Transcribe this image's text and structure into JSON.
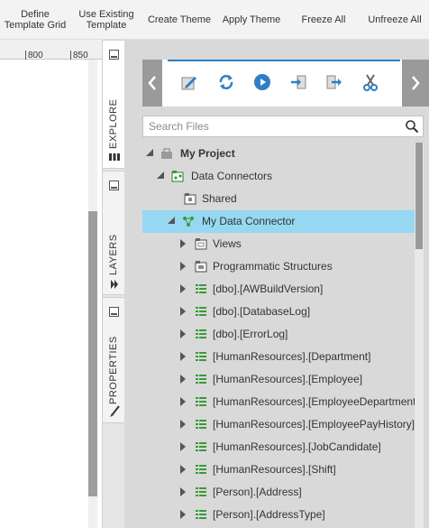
{
  "toolbar": {
    "items": [
      {
        "label": "Define\nTemplate Grid"
      },
      {
        "label": "Use Existing\nTemplate"
      },
      {
        "label": "Create Theme"
      },
      {
        "label": "Apply Theme"
      },
      {
        "label": "Freeze All"
      },
      {
        "label": "Unfreeze All"
      }
    ]
  },
  "ruler": {
    "labels": [
      "800",
      "850"
    ]
  },
  "side_tabs": [
    {
      "label": "EXPLORE",
      "icon": "database-icon",
      "active": true
    },
    {
      "label": "LAYERS",
      "icon": "layers-icon",
      "active": false
    },
    {
      "label": "PROPERTIES",
      "icon": "brush-icon",
      "active": false
    }
  ],
  "ribbon": {
    "tools": [
      "edit-icon",
      "refresh-icon",
      "play-icon",
      "import-icon",
      "export-icon",
      "cut-icon"
    ]
  },
  "search": {
    "placeholder": "Search Files",
    "value": ""
  },
  "tree": [
    {
      "label": "My Project",
      "level": 0,
      "caret": "open",
      "icon": "project-icon",
      "bold": true
    },
    {
      "label": "Data Connectors",
      "level": 1,
      "caret": "open",
      "icon": "data-connectors-folder-icon"
    },
    {
      "label": "Shared",
      "level": 2,
      "caret": "none",
      "icon": "shared-folder-icon"
    },
    {
      "label": "My Data Connector",
      "level": 2,
      "caret": "open",
      "icon": "data-connector-icon",
      "selected": true
    },
    {
      "label": "Views",
      "level": 3,
      "caret": "closed",
      "icon": "views-folder-icon"
    },
    {
      "label": "Programmatic Structures",
      "level": 3,
      "caret": "closed",
      "icon": "structures-folder-icon"
    },
    {
      "label": "[dbo].[AWBuildVersion]",
      "level": 3,
      "caret": "closed",
      "icon": "table-icon"
    },
    {
      "label": "[dbo].[DatabaseLog]",
      "level": 3,
      "caret": "closed",
      "icon": "table-icon"
    },
    {
      "label": "[dbo].[ErrorLog]",
      "level": 3,
      "caret": "closed",
      "icon": "table-icon"
    },
    {
      "label": "[HumanResources].[Department]",
      "level": 3,
      "caret": "closed",
      "icon": "table-icon"
    },
    {
      "label": "[HumanResources].[Employee]",
      "level": 3,
      "caret": "closed",
      "icon": "table-icon"
    },
    {
      "label": "[HumanResources].[EmployeeDepartmentH",
      "level": 3,
      "caret": "closed",
      "icon": "table-icon"
    },
    {
      "label": "[HumanResources].[EmployeePayHistory]",
      "level": 3,
      "caret": "closed",
      "icon": "table-icon"
    },
    {
      "label": "[HumanResources].[JobCandidate]",
      "level": 3,
      "caret": "closed",
      "icon": "table-icon"
    },
    {
      "label": "[HumanResources].[Shift]",
      "level": 3,
      "caret": "closed",
      "icon": "table-icon"
    },
    {
      "label": "[Person].[Address]",
      "level": 3,
      "caret": "closed",
      "icon": "table-icon"
    },
    {
      "label": "[Person].[AddressType]",
      "level": 3,
      "caret": "closed",
      "icon": "table-icon"
    }
  ],
  "colors": {
    "accent": "#2f7fc4",
    "selected": "#96d8f2",
    "green": "#3a9a3a",
    "panel": "#d9d9d9"
  }
}
